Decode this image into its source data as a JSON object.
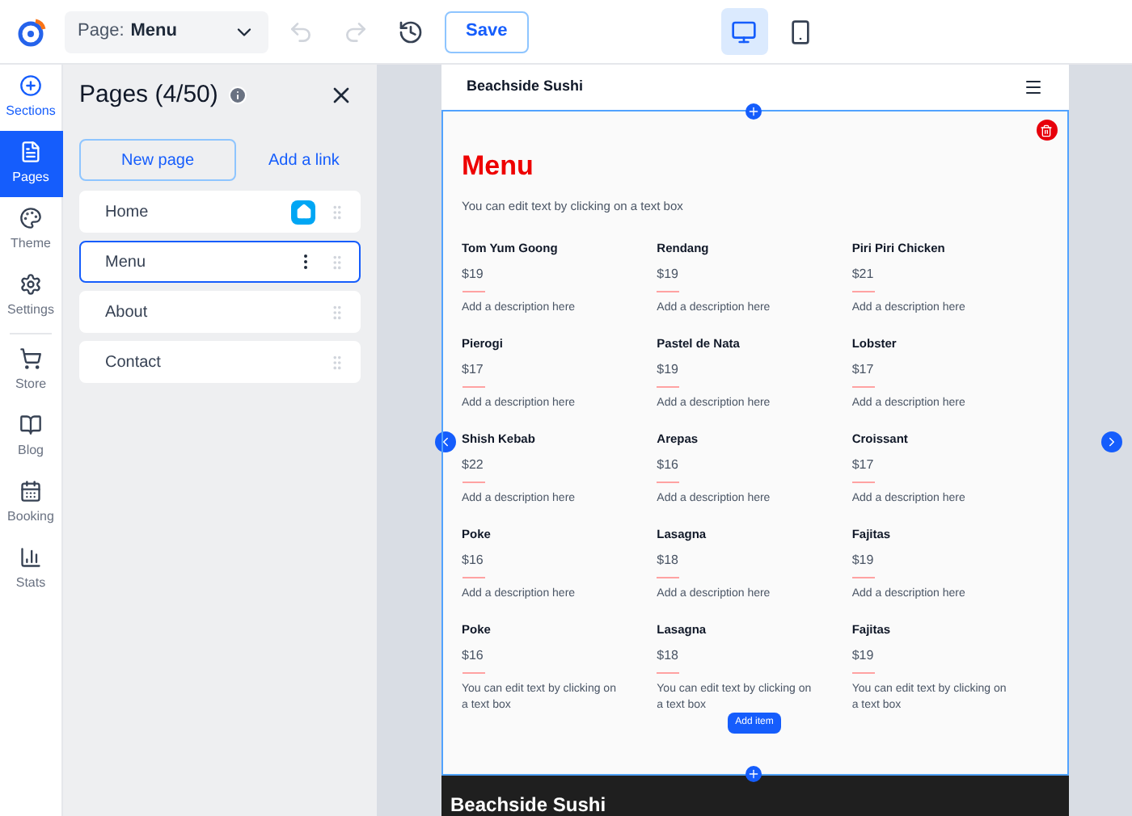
{
  "toolbar": {
    "page_select": {
      "label": "Page:",
      "value": "Menu"
    },
    "save": "Save",
    "devices": [
      {
        "kind": "desktop",
        "selected": true
      },
      {
        "kind": "mobile",
        "selected": false
      }
    ]
  },
  "rail": [
    {
      "kind": "sections",
      "label": "Sections",
      "selected": false
    },
    {
      "kind": "pages",
      "label": "Pages",
      "selected": true
    },
    {
      "kind": "theme",
      "label": "Theme",
      "selected": false
    },
    {
      "kind": "settings",
      "label": "Settings",
      "selected": false
    },
    {
      "kind": "store",
      "label": "Store",
      "selected": false
    },
    {
      "kind": "blog",
      "label": "Blog",
      "selected": false
    },
    {
      "kind": "booking",
      "label": "Booking",
      "selected": false
    },
    {
      "kind": "stats",
      "label": "Stats",
      "selected": false
    }
  ],
  "pages_panel": {
    "title": "Pages (4/50)",
    "new_page": "New page",
    "add_link": "Add a link",
    "pages": [
      {
        "label": "Home",
        "home": true,
        "selected": false
      },
      {
        "label": "Menu",
        "home": false,
        "selected": true
      },
      {
        "label": "About",
        "home": false,
        "selected": false
      },
      {
        "label": "Contact",
        "home": false,
        "selected": false
      }
    ]
  },
  "preview": {
    "site_name": "Beachside Sushi",
    "heading": "Menu",
    "intro": "You can edit text by clicking on a text box",
    "items": [
      {
        "name": "Tom Yum Goong",
        "price": "$19",
        "description": "Add a description here"
      },
      {
        "name": "Rendang",
        "price": "$19",
        "description": "Add a description here"
      },
      {
        "name": "Piri Piri Chicken",
        "price": "$21",
        "description": "Add a description here"
      },
      {
        "name": "Pierogi",
        "price": "$17",
        "description": "Add a description here"
      },
      {
        "name": "Pastel de Nata",
        "price": "$19",
        "description": "Add a description here"
      },
      {
        "name": "Lobster",
        "price": "$17",
        "description": "Add a description here"
      },
      {
        "name": "Shish Kebab",
        "price": "$22",
        "description": "Add a description here"
      },
      {
        "name": "Arepas",
        "price": "$16",
        "description": "Add a description here"
      },
      {
        "name": "Croissant",
        "price": "$17",
        "description": "Add a description here"
      },
      {
        "name": "Poke",
        "price": "$16",
        "description": "Add a description here"
      },
      {
        "name": "Lasagna",
        "price": "$18",
        "description": "Add a description here"
      },
      {
        "name": "Fajitas",
        "price": "$19",
        "description": "Add a description here"
      },
      {
        "name": "Poke",
        "price": "$16",
        "description": "You can edit text by clicking on a text box"
      },
      {
        "name": "Lasagna",
        "price": "$18",
        "description": "You can edit text by clicking on a text box"
      },
      {
        "name": "Fajitas",
        "price": "$19",
        "description": "You can edit text by clicking on a text box"
      }
    ],
    "add_item": "Add item",
    "footer_name": "Beachside Sushi"
  }
}
